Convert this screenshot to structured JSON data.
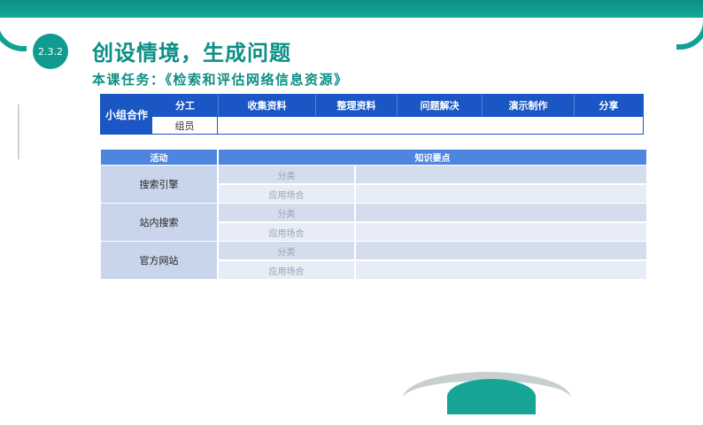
{
  "header": {
    "section_number": "2.3.2",
    "title": "创设情境，生成问题",
    "task": "本课任务：《检索和评估网络信息资源》"
  },
  "group_table": {
    "label": "小组合作",
    "columns": [
      "分工",
      "收集资料",
      "整理资料",
      "问题解决",
      "演示制作",
      "分享"
    ],
    "member_label": "组员"
  },
  "knowledge_table": {
    "headers": [
      "活动",
      "知识要点"
    ],
    "groups": [
      {
        "activity": "搜索引擎",
        "rows": [
          "分类",
          "应用场合"
        ]
      },
      {
        "activity": "站内搜索",
        "rows": [
          "分类",
          "应用场合"
        ]
      },
      {
        "activity": "官方网站",
        "rows": [
          "分类",
          "应用场合"
        ]
      }
    ]
  },
  "colors": {
    "brand_teal": "#0b8f86",
    "table_blue": "#1b57c4",
    "header_blue": "#4e86dd"
  }
}
